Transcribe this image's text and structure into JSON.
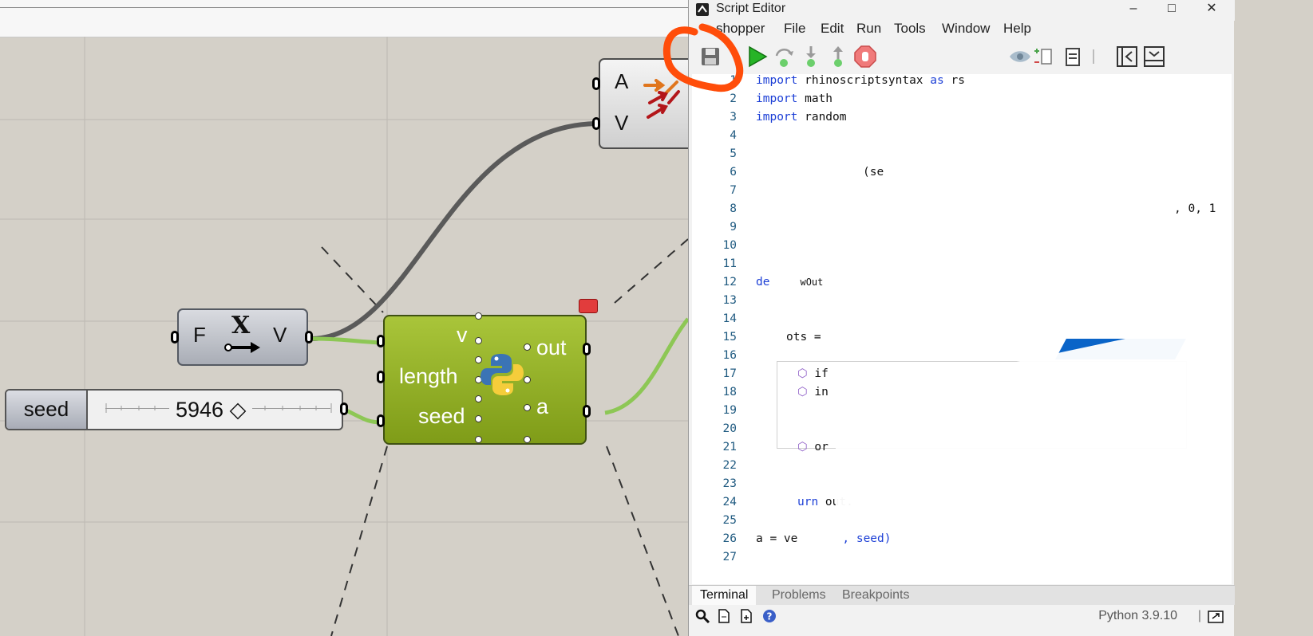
{
  "canvas": {
    "vector_display": {
      "inputs": [
        "A",
        "V"
      ]
    },
    "deconstruct_vector": {
      "input": "F",
      "glyph": "X",
      "output": "V"
    },
    "seed_slider": {
      "name": "seed",
      "value": "5946 ◇"
    },
    "python_component": {
      "inputs": [
        "v",
        "length",
        "seed"
      ],
      "outputs": [
        "out",
        "a"
      ]
    }
  },
  "editor": {
    "window_title": "Script Editor",
    "window_buttons": {
      "minimize": "–",
      "maximize": "□",
      "close": "✕"
    },
    "menu": [
      "shopper",
      "File",
      "Edit",
      "Run",
      "Tools",
      "Window",
      "Help"
    ],
    "toolbar_icons": [
      "save-icon",
      "run-icon",
      "step-over-icon",
      "step-into-icon",
      "step-out-icon",
      "stop-icon",
      "eye-icon",
      "outline-icon",
      "clipboard-icon",
      "collapse-left-icon",
      "dock-panel-icon"
    ],
    "line_numbers": [
      "1",
      "2",
      "3",
      "4",
      "5",
      "6",
      "7",
      "8",
      "9",
      "10",
      "11",
      "12",
      "13",
      "14",
      "15",
      "16",
      "17",
      "18",
      "19",
      "20",
      "21",
      "22",
      "23",
      "24",
      "25",
      "26",
      "27"
    ],
    "code_lines": {
      "l1_kw": "import",
      "l1_rest": " rhinoscriptsyntax ",
      "l1_as": "as",
      "l1_end": " rs",
      "l2_kw": "import",
      "l2_rest": " math",
      "l3_kw": "import",
      "l3_rest": " random",
      "l6": "(se",
      "l8": ", 0, 1",
      "l12_kw": "de",
      "l12_rest": "wOut",
      "l15": "ots = ",
      "l17": "if",
      "l18": "in",
      "l21": "or",
      "l24_kw": "urn",
      "l24_rest": " out.",
      "l26_a": "a = ve",
      "l26_b": ", seed)"
    },
    "bottom_tabs": [
      "Terminal",
      "Problems",
      "Breakpoints"
    ],
    "status": "Python 3.9.10",
    "status_separator": "|"
  },
  "colors": {
    "annotation": "#ff4d0a",
    "python_green": "#8db226",
    "wire_dark": "#555555",
    "wire_green": "#8dc755",
    "keyword_blue": "#1c3fd6"
  }
}
